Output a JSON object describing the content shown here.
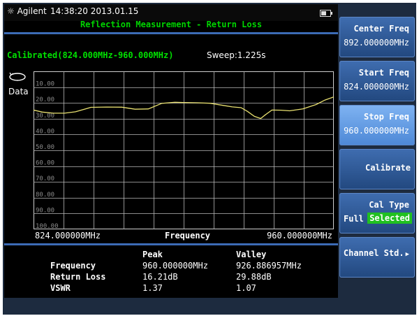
{
  "header": {
    "brand": "Agilent",
    "datetime": "14:38:20 2013.01.15",
    "measurement_title": "Reflection Measurement - Return Loss",
    "battery_level": 0.6
  },
  "status": {
    "calibration": "Calibrated(824.000MHz-960.000MHz)",
    "sweep": "Sweep:1.225s",
    "trace_label": "Data"
  },
  "chart_data": {
    "type": "line",
    "xlabel": "Frequency",
    "x_start_label": "824.000000MHz",
    "x_end_label": "960.000000MHz",
    "xlim": [
      824,
      960
    ],
    "ylim": [
      0,
      100
    ],
    "y_inverted": true,
    "yticks": [
      "10.00",
      "20.00",
      "30.00",
      "40.00",
      "50.00",
      "60.00",
      "70.00",
      "80.00",
      "90.00",
      "100.00"
    ],
    "grid": true,
    "series": [
      {
        "color": "#e8e070",
        "x": [
          824,
          828,
          833,
          838,
          843,
          850,
          857,
          864,
          870,
          876,
          882,
          888,
          892,
          898,
          904,
          910,
          914,
          918,
          921,
          924,
          926.9,
          929,
          932,
          936,
          940,
          946,
          952,
          956,
          960
        ],
        "y": [
          24.5,
          25.8,
          26.5,
          26.5,
          25.6,
          22.8,
          22.6,
          22.7,
          24.0,
          23.8,
          20.3,
          19.6,
          19.8,
          19.9,
          20.2,
          21.6,
          22.5,
          23.0,
          25.5,
          28.5,
          29.88,
          27.5,
          24.5,
          24.6,
          25.0,
          23.8,
          21.0,
          18.2,
          16.21
        ]
      }
    ]
  },
  "results": {
    "headers": [
      "Peak",
      "Valley"
    ],
    "rows": [
      {
        "label": "Frequency",
        "peak": "960.000000MHz",
        "valley": "926.886957MHz"
      },
      {
        "label": "Return Loss",
        "peak": "16.21dB",
        "valley": "29.88dB"
      },
      {
        "label": "VSWR",
        "peak": "1.37",
        "valley": "1.07"
      }
    ]
  },
  "softkeys": {
    "center_freq": {
      "title": "Center Freq",
      "value": "892.000000MHz"
    },
    "start_freq": {
      "title": "Start Freq",
      "value": "824.000000MHz"
    },
    "stop_freq": {
      "title": "Stop Freq",
      "value": "960.000000MHz"
    },
    "calibrate": {
      "title": "Calibrate"
    },
    "cal_type": {
      "title": "Cal Type",
      "option": "Full",
      "state": "Selected"
    },
    "channel_std": {
      "title": "Channel Std.",
      "arrow": "▶"
    }
  },
  "colors": {
    "accent_green": "#00d400",
    "trace": "#e8e070",
    "softkey_blue": "#2f5c9d",
    "softkey_active": "#6aa2e8",
    "selected_badge": "#20c020"
  }
}
